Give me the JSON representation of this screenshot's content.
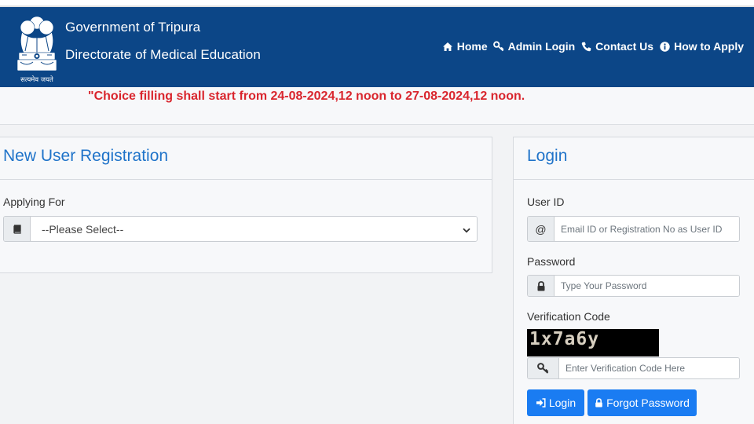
{
  "header": {
    "org_line1": "Government of Tripura",
    "org_line2": "Directorate of Medical Education",
    "emblem_motto": "सत्यमेव जयते",
    "background": "#0c4687"
  },
  "nav": {
    "items": [
      {
        "label": "Home",
        "icon": "home-icon"
      },
      {
        "label": "Admin Login",
        "icon": "key-icon"
      },
      {
        "label": "Contact Us",
        "icon": "phone-icon"
      },
      {
        "label": "How to Apply",
        "icon": "info-circle-icon"
      }
    ]
  },
  "announcement": {
    "text": "\"Choice filling shall start from 24-08-2024,12 noon to 27-08-2024,12 noon.",
    "color": "#d9262e"
  },
  "registration": {
    "title": "New User Registration",
    "applying_for_label": "Applying For",
    "applying_for_selected": "--Please Select--",
    "addon_icon": "book-icon"
  },
  "login": {
    "title": "Login",
    "user_id_label": "User ID",
    "user_id_addon": "@",
    "user_id_placeholder": "Email ID or Registration No as User ID",
    "password_label": "Password",
    "password_addon_icon": "lock-icon",
    "password_placeholder": "Type Your Password",
    "verification_label": "Verification Code",
    "captcha_text": "1x7a6y",
    "verification_addon_icon": "key-icon",
    "verification_placeholder": "Enter Verification Code Here",
    "login_button": "Login",
    "login_button_icon": "sign-in-icon",
    "forgot_button": "Forgot Password",
    "forgot_button_icon": "lock-icon",
    "accent": "#1a7cf2"
  }
}
